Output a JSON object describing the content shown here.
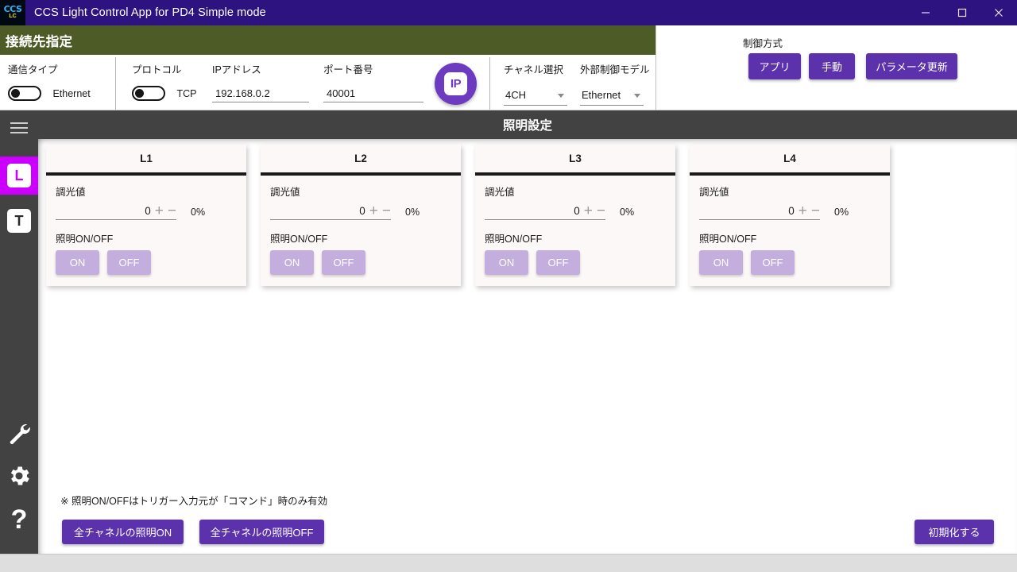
{
  "window": {
    "title": "CCS Light Control App for PD4 Simple mode",
    "icon": "ccs-lc-logo",
    "controls": {
      "minimize": "minimize-icon",
      "maximize": "maximize-icon",
      "close": "close-icon"
    }
  },
  "connection": {
    "header": "接続先指定",
    "comm_type": {
      "label": "通信タイプ",
      "value": "Ethernet",
      "toggle_state": "off"
    },
    "protocol": {
      "label": "プロトコル",
      "value": "TCP",
      "toggle_state": "off"
    },
    "ip_address": {
      "label": "IPアドレス",
      "value": "192.168.0.2",
      "placeholder": "192.168.0.2"
    },
    "port": {
      "label": "ポート番号",
      "value": "40001",
      "placeholder": "40001"
    },
    "ip_button": {
      "label": "IP",
      "name": "ip-indicator-button"
    },
    "channel": {
      "label": "チャネル選択",
      "value": "4CH"
    },
    "external_model": {
      "label": "外部制御モデル",
      "value": "Ethernet"
    }
  },
  "control_mode": {
    "label": "制御方式",
    "app_button": "アプリ",
    "manual_button": "手動",
    "update_button": "パラメータ更新"
  },
  "sidebar": {
    "hamburger": "menu-icon",
    "items": [
      {
        "label": "L",
        "name": "sidebar-item-light",
        "active": true
      },
      {
        "label": "T",
        "name": "sidebar-item-trigger",
        "active": false
      }
    ],
    "tools": [
      {
        "name": "wrench-icon"
      },
      {
        "name": "gear-icon"
      },
      {
        "name": "help-icon",
        "label": "?"
      }
    ]
  },
  "main": {
    "title": "照明設定",
    "cards": [
      {
        "title": "L1",
        "dim_label": "調光値",
        "dim_value": "0",
        "dim_percent": "0%",
        "onoff_label": "照明ON/OFF",
        "on": "ON",
        "off": "OFF"
      },
      {
        "title": "L2",
        "dim_label": "調光値",
        "dim_value": "0",
        "dim_percent": "0%",
        "onoff_label": "照明ON/OFF",
        "on": "ON",
        "off": "OFF"
      },
      {
        "title": "L3",
        "dim_label": "調光値",
        "dim_value": "0",
        "dim_percent": "0%",
        "onoff_label": "照明ON/OFF",
        "on": "ON",
        "off": "OFF"
      },
      {
        "title": "L4",
        "dim_label": "調光値",
        "dim_value": "0",
        "dim_percent": "0%",
        "onoff_label": "照明ON/OFF",
        "on": "ON",
        "off": "OFF"
      }
    ],
    "note": "※ 照明ON/OFFはトリガー入力元が「コマンド」時のみ有効",
    "all_on_button": "全チャネルの照明ON",
    "all_off_button": "全チャネルの照明OFF",
    "reset_button": "初期化する"
  },
  "colors": {
    "titlebar": "#2d1380",
    "green_header": "#4d5c27",
    "accent_purple": "#5b32ab",
    "ip_purple": "#6d3bbf",
    "active_magenta": "#cc00ff",
    "sidebar_gray": "#424242",
    "disabled_purple": "#c4aedd"
  }
}
